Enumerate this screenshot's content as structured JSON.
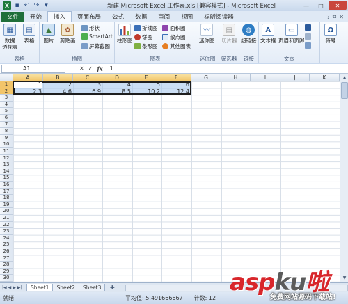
{
  "title_bar": {
    "title": "新建 Microsoft Excel 工作表.xls [兼容模式] - Microsoft Excel",
    "app_icon": "X",
    "minimize": "—",
    "maximize": "□",
    "close": "✕"
  },
  "tabs": {
    "file": "文件",
    "items": [
      "开始",
      "插入",
      "页面布局",
      "公式",
      "数据",
      "审阅",
      "视图",
      "福昕阅读器"
    ],
    "active_index": 1
  },
  "ribbon": {
    "groups": {
      "table": "表格",
      "illustration": "插图",
      "chart": "图表",
      "sparkline": "迷你图",
      "filter": "筛选器",
      "links": "链接",
      "text": "文本"
    },
    "buttons": {
      "pivot_line1": "数据",
      "pivot_line2": "透视表",
      "table": "表格",
      "picture": "图片",
      "clipart": "剪贴画",
      "shapes": "形状",
      "smartart": "SmartArt",
      "screenshot": "屏幕截图",
      "column_chart": "柱形图",
      "line_chart": "折线图",
      "pie_chart": "饼图",
      "bar_chart": "条形图",
      "area_chart": "面积图",
      "scatter_chart": "散点图",
      "other_chart": "其他图表",
      "sparkline": "迷你图",
      "slicer": "切片器",
      "hyperlink": "超链接",
      "textbox": "文本框",
      "header_footer": "页眉和页脚",
      "symbol": "符号"
    }
  },
  "formula_bar": {
    "name_box": "A1",
    "fx": "fx",
    "value": "1"
  },
  "sheet": {
    "columns": [
      "A",
      "B",
      "C",
      "D",
      "E",
      "F",
      "G",
      "H",
      "I",
      "J",
      "K"
    ],
    "rows": [
      "1",
      "2",
      "3",
      "4",
      "5",
      "6",
      "7",
      "8",
      "9",
      "10",
      "11",
      "12",
      "13",
      "14",
      "15",
      "16",
      "17",
      "18",
      "19",
      "20",
      "21",
      "22",
      "23",
      "24",
      "25",
      "26",
      "27",
      "28",
      "29",
      "30"
    ],
    "data": [
      [
        "1",
        "2",
        "3",
        "4",
        "5",
        "6"
      ],
      [
        "2.3",
        "4.6",
        "6.9",
        "8.5",
        "10.2",
        "12.4"
      ]
    ]
  },
  "sheet_tabs": [
    "Sheet1",
    "Sheet2",
    "Sheet3"
  ],
  "status_bar": {
    "ready": "就绪",
    "average": "平均值: 5.491666667",
    "count": "计数: 12"
  },
  "watermark": {
    "brand_a": "asp",
    "brand_b": "ku",
    "brand_c": "啦",
    "subtitle": "免费网站源码下载站!"
  }
}
